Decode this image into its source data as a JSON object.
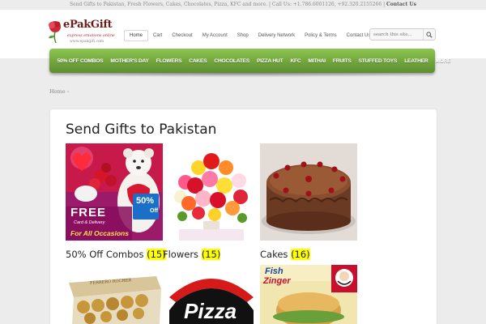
{
  "topbar": {
    "text": "Send Gifts to Pakistan, Fresh Flowers, Cakes, Chocolates, Pizza, KFC and more. | Call Us: +1.786.6001126, +92.320.2155266 |",
    "contact_link": "Contact Us"
  },
  "logo": {
    "name": "ePakGift",
    "tagline": "express emotions online",
    "url": "www.epakgift.com"
  },
  "topnav": [
    "Home",
    "Cart",
    "Checkout",
    "My Account",
    "Shop",
    "Delivery Network",
    "Policy & Terms",
    "Contact Us"
  ],
  "search": {
    "placeholder": "search this site..."
  },
  "categories_nav": [
    "50% OFF COMBOS",
    "MOTHER'S DAY",
    "FLOWERS",
    "CAKES",
    "CHOCOLATES",
    "PIZZA HUT",
    "KFC",
    "MITHAI",
    "FRUITS",
    "STUFFED TOYS",
    "LEATHER",
    "MORE"
  ],
  "breadcrumb": {
    "home": "Home",
    "separator": "›"
  },
  "page": {
    "title": "Send Gifts to Pakistan"
  },
  "categories": [
    {
      "name": "50% Off Combos",
      "count": "(15)",
      "icon": "teddy-roses-combo-image",
      "banner_text": "FREE",
      "banner_sub": "Card & Delivery",
      "banner_bottom": "For All Occasions",
      "badge": "50%",
      "badge_sub": "Off"
    },
    {
      "name": "Flowers",
      "count": "(15)",
      "icon": "rose-bouquet-image"
    },
    {
      "name": "Cakes",
      "count": "(16)",
      "icon": "chocolate-cake-image"
    },
    {
      "name": "",
      "count": "",
      "icon": "ferrero-rocher-box-image",
      "box_text": "FERRERO ROCHER"
    },
    {
      "name": "",
      "count": "",
      "icon": "pizza-hut-logo-image",
      "logo_text": "Pizza"
    },
    {
      "name": "",
      "count": "",
      "icon": "kfc-zinger-burger-image",
      "promo_text": "Fish",
      "promo_text2": "Zinger"
    }
  ],
  "colors": {
    "accent_green": "#7ab143",
    "highlight": "#ffff00",
    "logo_red": "#b8232a"
  }
}
